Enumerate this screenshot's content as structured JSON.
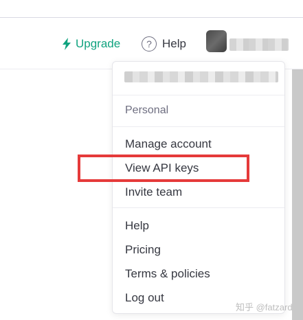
{
  "header": {
    "upgrade_label": "Upgrade",
    "help_label": "Help",
    "help_icon_glyph": "?"
  },
  "menu": {
    "section_label": "Personal",
    "account_items": [
      {
        "label": "Manage account"
      },
      {
        "label": "View API keys"
      },
      {
        "label": "Invite team"
      }
    ],
    "footer_items": [
      {
        "label": "Help"
      },
      {
        "label": "Pricing"
      },
      {
        "label": "Terms & policies"
      },
      {
        "label": "Log out"
      }
    ]
  },
  "watermark": {
    "text": "知乎 @fatzard"
  },
  "colors": {
    "accent": "#10a37f",
    "highlight": "#e53a3a"
  }
}
